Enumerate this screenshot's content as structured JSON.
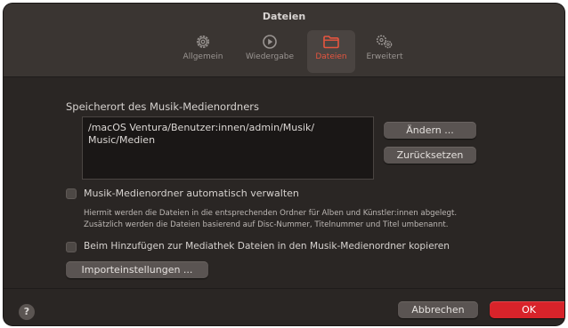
{
  "window": {
    "title": "Dateien"
  },
  "tabs": [
    {
      "label": "Allgemein",
      "icon": "gear-icon"
    },
    {
      "label": "Wiedergabe",
      "icon": "play-circle-icon"
    },
    {
      "label": "Dateien",
      "icon": "folder-icon",
      "active": true
    },
    {
      "label": "Erweitert",
      "icon": "gears-icon"
    }
  ],
  "colors": {
    "accent": "#e6553f",
    "ok_button": "#d8232a"
  },
  "media_folder": {
    "label": "Speicherort des Musik-Medienordners",
    "path_line1": "/macOS Ventura/Benutzer:innen/admin/Musik/",
    "path_line2": "Music/Medien",
    "change_button": "Ändern ...",
    "reset_button": "Zurücksetzen"
  },
  "options": {
    "auto_manage_label": "Musik-Medienordner automatisch verwalten",
    "auto_manage_desc_line1": "Hiermit werden die Dateien in die entsprechenden Ordner für Alben und Künstler:innen abgelegt.",
    "auto_manage_desc_line2": "Zusätzlich werden die Dateien basierend auf Disc-Nummer, Titelnummer und Titel umbenannt.",
    "copy_files_label": "Beim Hinzufügen zur Mediathek Dateien in den Musik-Medienordner kopieren",
    "import_settings_button": "Importeinstellungen ..."
  },
  "footer": {
    "help_label": "?",
    "cancel_button": "Abbrechen",
    "ok_button": "OK"
  }
}
